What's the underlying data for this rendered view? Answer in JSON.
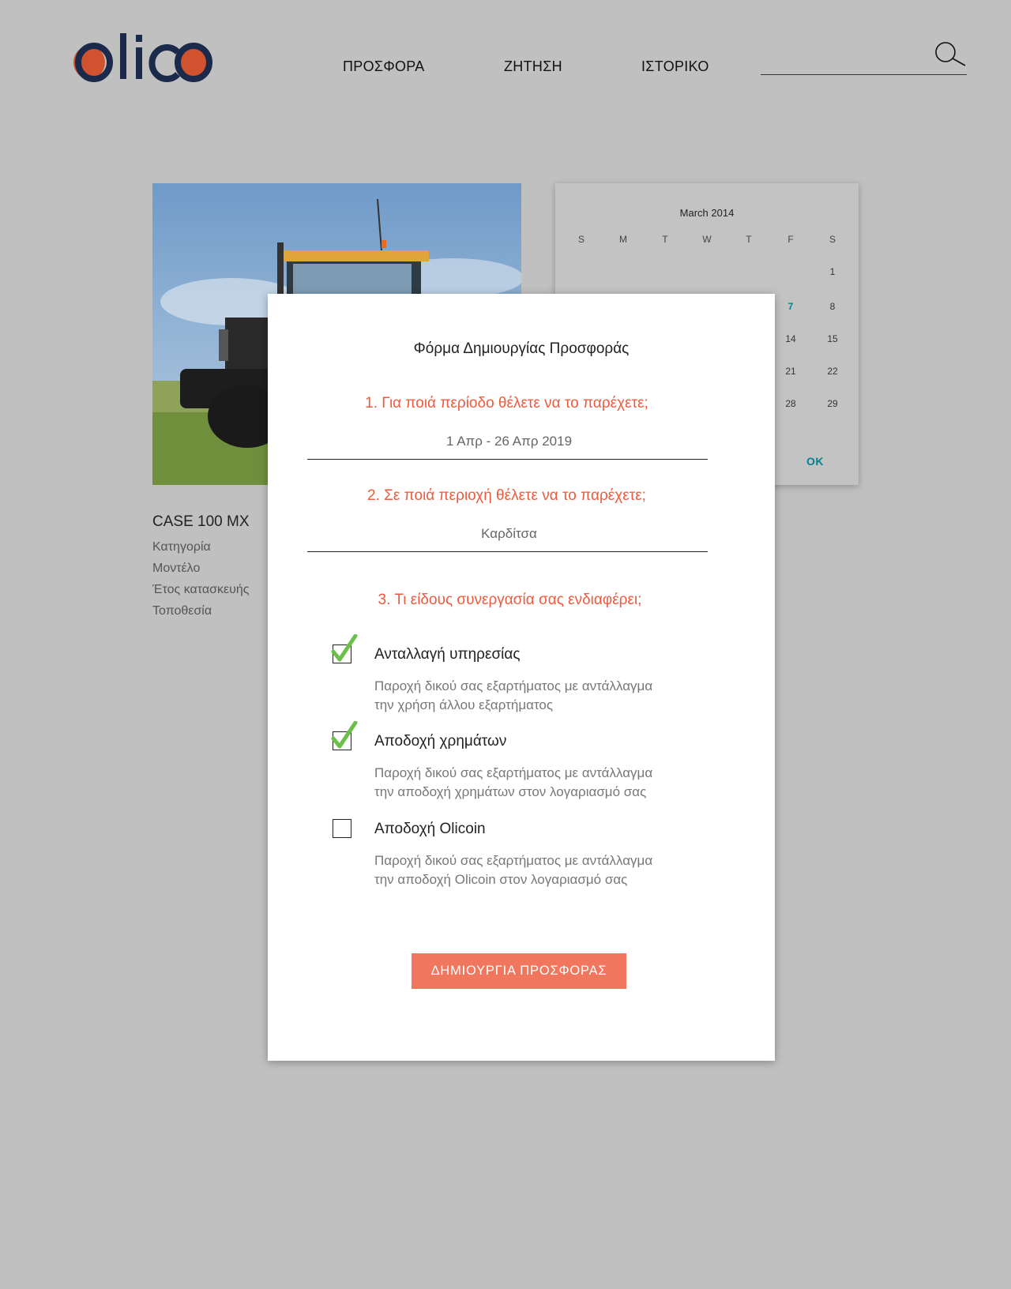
{
  "header": {
    "logo_text": "olico",
    "nav": [
      "ΠΡΟΣΦΟΡΑ",
      "ΖΗΤΗΣΗ",
      "ΙΣΤΟΡΙΚΟ"
    ],
    "search_value": ""
  },
  "product": {
    "title": "CASE 100 MX",
    "fields": [
      "Κατηγορία",
      "Μοντέλο",
      "Έτος κατασκευής",
      "Τοποθεσία"
    ]
  },
  "calendar": {
    "title": "March 2014",
    "weekdays": [
      "S",
      "M",
      "T",
      "W",
      "T",
      "F",
      "S"
    ],
    "visible_days": [
      "1",
      "7",
      "8",
      "14",
      "15",
      "21",
      "22",
      "28",
      "29"
    ],
    "selected_day": "7",
    "ok_label": "OK"
  },
  "modal": {
    "title": "Φόρμα Δημιουργίας Προσφοράς",
    "q1": "1. Για ποιά περίοδο θέλετε να το παρέχετε;",
    "period_value": "1 Απρ - 26 Απρ 2019",
    "q2": "2. Σε ποιά περιοχή θέλετε να το παρέχετε;",
    "region_value": "Καρδίτσα",
    "q3": "3. Τι είδους συνεργασία σας ενδιαφέρει;",
    "options": [
      {
        "label": "Ανταλλαγή υπηρεσίας",
        "checked": true,
        "desc1": "Παροχή δικού σας εξαρτήματος με αντάλλαγμα",
        "desc2": "την χρήση άλλου εξαρτήματος"
      },
      {
        "label": "Αποδοχή χρημάτων",
        "checked": true,
        "desc1": "Παροχή δικού σας εξαρτήματος με αντάλλαγμα",
        "desc2": "την αποδοχή χρημάτων στον λογαριασμό σας"
      },
      {
        "label": "Αποδοχή Olicoin",
        "checked": false,
        "desc1": "Παροχή δικού σας εξαρτήματος με αντάλλαγμα",
        "desc2": "την αποδοχή Olicoin στον λογαριασμό σας"
      }
    ],
    "submit_label": "ΔΗΜΙΟΥΡΓΙΑ ΠΡΟΣΦΟΡΑΣ"
  },
  "colors": {
    "background": "#c0c0c0",
    "accent": "#ee5a3c",
    "button": "#f0775e",
    "logo_dark": "#1b2a4a",
    "logo_orange": "#d0522e",
    "calendar_selected": "#00838f",
    "check_green": "#6cc04a"
  }
}
